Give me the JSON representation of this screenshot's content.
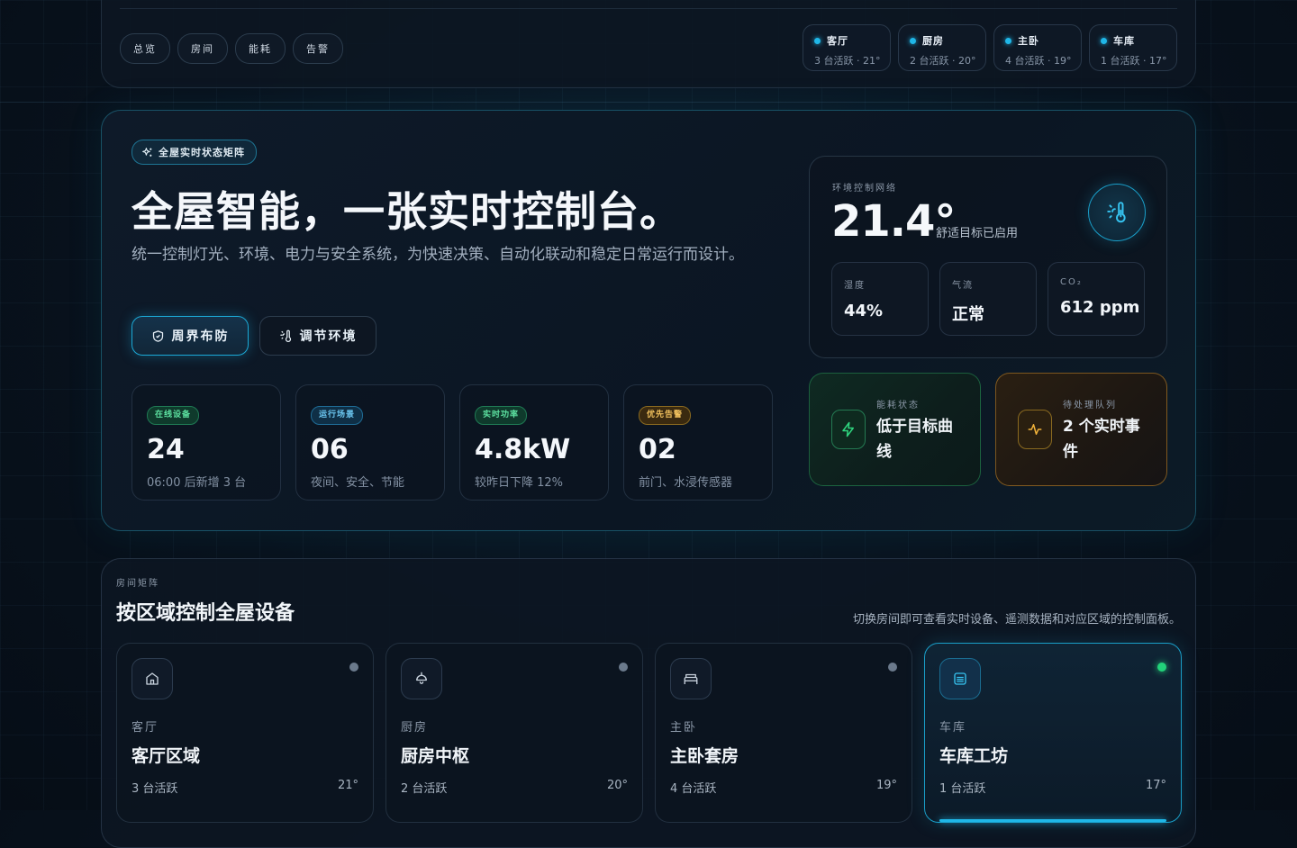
{
  "nav": {
    "items": [
      "总览",
      "房间",
      "能耗",
      "告警"
    ]
  },
  "room_chips": [
    {
      "name": "客厅",
      "sub": "3 台活跃 · 21°"
    },
    {
      "name": "厨房",
      "sub": "2 台活跃 · 20°"
    },
    {
      "name": "主卧",
      "sub": "4 台活跃 · 19°"
    },
    {
      "name": "车库",
      "sub": "1 台活跃 · 17°"
    }
  ],
  "hero": {
    "badge": "全屋实时状态矩阵",
    "title": "全屋智能，一张实时控制台。",
    "description": "统一控制灯光、环境、电力与安全系统，为快速决策、自动化联动和稳定日常运行而设计。",
    "primary_button": "周界布防",
    "secondary_button": "调节环境"
  },
  "stats": [
    {
      "tag": "在线设备",
      "value": "24",
      "sub": "06:00 后新增 3 台"
    },
    {
      "tag": "运行场景",
      "value": "06",
      "sub": "夜间、安全、节能"
    },
    {
      "tag": "实时功率",
      "value": "4.8kW",
      "sub": "较昨日下降 12%"
    },
    {
      "tag": "优先告警",
      "value": "02",
      "sub": "前门、水浸传感器"
    }
  ],
  "environment": {
    "label": "环境控制网络",
    "temperature": "21.4°",
    "status": "舒适目标已启用",
    "cells": [
      {
        "label": "湿度",
        "value": "44%"
      },
      {
        "label": "气流",
        "value": "正常"
      },
      {
        "label": "CO₂",
        "value": "612 ppm"
      }
    ]
  },
  "energy": {
    "label": "能耗状态",
    "value": "低于目标曲线"
  },
  "alerts": {
    "label": "待处理队列",
    "value": "2 个实时事件"
  },
  "rooms": {
    "label": "房间矩阵",
    "title": "按区域控制全屋设备",
    "description": "切换房间即可查看实时设备、遥测数据和对应区域的控制面板。",
    "cards": [
      {
        "label": "客厅",
        "name": "客厅区域",
        "active_devices": "3 台活跃",
        "temp": "21°"
      },
      {
        "label": "厨房",
        "name": "厨房中枢",
        "active_devices": "2 台活跃",
        "temp": "20°"
      },
      {
        "label": "主卧",
        "name": "主卧套房",
        "active_devices": "4 台活跃",
        "temp": "19°"
      },
      {
        "label": "车库",
        "name": "车库工坊",
        "active_devices": "1 台活跃",
        "temp": "17°"
      }
    ]
  },
  "colors": {
    "accent_cyan": "#1fb7e8",
    "status_green": "#22d37a",
    "warning_amber": "#f2c25e",
    "background": "#08121d"
  }
}
